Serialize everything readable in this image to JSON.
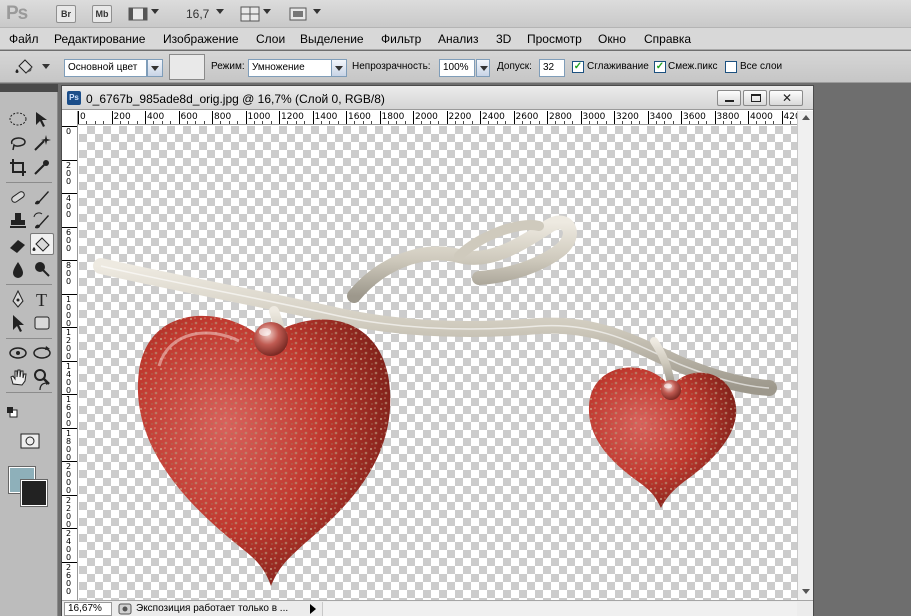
{
  "app": {
    "logo": "Ps",
    "bridge_label": "Br",
    "minibridge_label": "Mb",
    "zoom_level": "16,7"
  },
  "menu": {
    "items": [
      "Файл",
      "Редактирование",
      "Изображение",
      "Слои",
      "Выделение",
      "Фильтр",
      "Анализ",
      "3D",
      "Просмотр",
      "Окно",
      "Справка"
    ]
  },
  "options": {
    "fill_source": "Основной цвет",
    "mode_label": "Режим:",
    "mode_value": "Умножение",
    "opacity_label": "Непрозрачность:",
    "opacity_value": "100%",
    "tolerance_label": "Допуск:",
    "tolerance_value": "32",
    "antialias_label": "Сглаживание",
    "antialias_checked": true,
    "contiguous_label": "Смеж.пикс",
    "contiguous_checked": true,
    "all_layers_label": "Все слои",
    "all_layers_checked": false
  },
  "tools": {
    "active": "paint-bucket-tool",
    "foreground_color": "#8eb0ba",
    "background_color": "#222222"
  },
  "document": {
    "title": "0_6767b_985ade8d_orig.jpg @ 16,7% (Слой 0, RGB/8)",
    "badge": "Ps",
    "ruler_top_labels": [
      "0",
      "200",
      "400",
      "600",
      "800",
      "1000",
      "1200",
      "1400",
      "1600",
      "1800",
      "2000",
      "2200",
      "2400",
      "2600",
      "2800",
      "3000",
      "3200",
      "3400",
      "3600",
      "3800",
      "4000",
      "420"
    ],
    "ruler_left_labels": [
      "0",
      "200",
      "400",
      "600",
      "800",
      "1000",
      "1200",
      "1400",
      "1600",
      "1800",
      "2000",
      "2200",
      "2400",
      "2600"
    ],
    "status_zoom": "16,67%",
    "status_text": "Экспозиция работает только в ..."
  }
}
